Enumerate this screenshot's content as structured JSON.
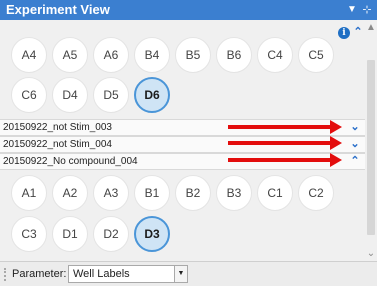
{
  "window": {
    "title": "Experiment View",
    "menu_icon": "dropdown-icon",
    "pin_icon": "pin-icon"
  },
  "wells_group1": [
    {
      "label": "A4",
      "selected": false
    },
    {
      "label": "A5",
      "selected": false
    },
    {
      "label": "A6",
      "selected": false
    },
    {
      "label": "B4",
      "selected": false
    },
    {
      "label": "B5",
      "selected": false
    },
    {
      "label": "B6",
      "selected": false
    },
    {
      "label": "C4",
      "selected": false
    },
    {
      "label": "C5",
      "selected": false
    },
    {
      "label": "C6",
      "selected": false
    },
    {
      "label": "D4",
      "selected": false
    },
    {
      "label": "D5",
      "selected": false
    },
    {
      "label": "D6",
      "selected": true
    }
  ],
  "groups": [
    {
      "name": "20150922_not Stim_003",
      "expanded": false
    },
    {
      "name": "20150922_not Stim_004",
      "expanded": false
    },
    {
      "name": "20150922_No compound_004",
      "expanded": true
    }
  ],
  "wells_group2": [
    {
      "label": "A1",
      "selected": false
    },
    {
      "label": "A2",
      "selected": false
    },
    {
      "label": "A3",
      "selected": false
    },
    {
      "label": "B1",
      "selected": false
    },
    {
      "label": "B2",
      "selected": false
    },
    {
      "label": "B3",
      "selected": false
    },
    {
      "label": "C1",
      "selected": false
    },
    {
      "label": "C2",
      "selected": false
    },
    {
      "label": "C3",
      "selected": false
    },
    {
      "label": "D1",
      "selected": false
    },
    {
      "label": "D2",
      "selected": false
    },
    {
      "label": "D3",
      "selected": true
    }
  ],
  "parameter": {
    "label": "Parameter:",
    "value": "Well Labels"
  },
  "colors": {
    "title_bar": "#3b7fd0",
    "selected_well_fill": "#cfe4f5",
    "selected_well_border": "#4a95d8",
    "annotation_arrow": "#e30d0d",
    "chevron": "#2a6fc9"
  }
}
